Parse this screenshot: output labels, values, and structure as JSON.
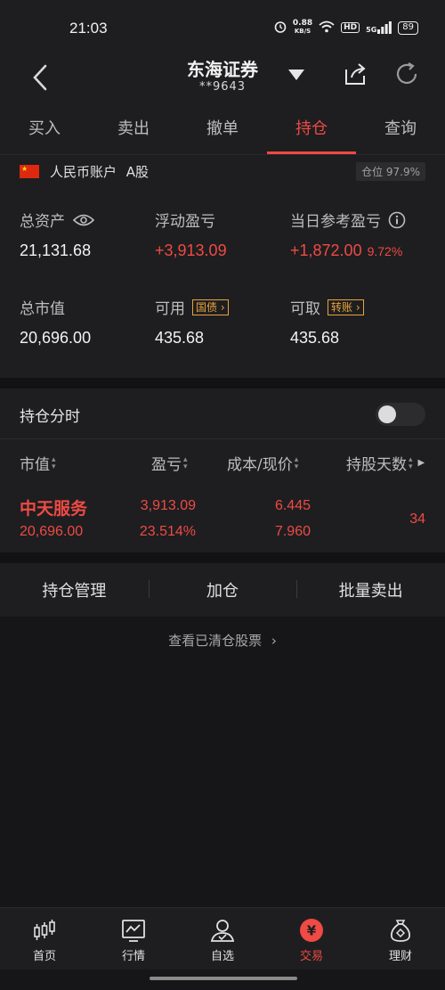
{
  "status": {
    "time": "21:03",
    "speed_value": "0.88",
    "speed_unit": "KB/S",
    "hd": "HD",
    "signal": "5G",
    "battery": "89"
  },
  "nav": {
    "title": "东海证券",
    "account_masked": "**9643"
  },
  "tabs": [
    {
      "label": "买入"
    },
    {
      "label": "卖出"
    },
    {
      "label": "撤单"
    },
    {
      "label": "持仓",
      "active": true
    },
    {
      "label": "查询"
    }
  ],
  "account": {
    "currency_label": "人民币账户",
    "market": "A股",
    "position_ratio": "仓位 97.9%",
    "total_assets_label": "总资产",
    "total_assets": "21,131.68",
    "floating_pl_label": "浮动盈亏",
    "floating_pl": "+3,913.09",
    "daily_pl_label": "当日参考盈亏",
    "daily_pl": "+1,872.00",
    "daily_pl_pct": "9.72%",
    "market_value_label": "总市值",
    "market_value": "20,696.00",
    "available_label": "可用",
    "available": "435.68",
    "bond_tag": "国债",
    "withdrawable_label": "可取",
    "withdrawable": "435.68",
    "transfer_tag": "转账"
  },
  "intraday_toggle": {
    "label": "持仓分时",
    "on": false
  },
  "table": {
    "headers": {
      "market_value": "市值",
      "pl": "盈亏",
      "cost_price": "成本/现价",
      "days": "持股天数"
    },
    "rows": [
      {
        "name": "中天服务",
        "market_value": "20,696.00",
        "pl": "3,913.09",
        "pl_pct": "23.514%",
        "cost": "6.445",
        "price": "7.960",
        "days": "34"
      }
    ]
  },
  "actions": {
    "manage": "持仓管理",
    "add": "加仓",
    "batch_sell": "批量卖出"
  },
  "cleared_link": "查看已清仓股票",
  "bottom_nav": [
    {
      "label": "首页",
      "icon": "candlestick-icon"
    },
    {
      "label": "行情",
      "icon": "chart-icon"
    },
    {
      "label": "自选",
      "icon": "user-icon"
    },
    {
      "label": "交易",
      "icon": "yuan-icon",
      "active": true
    },
    {
      "label": "理财",
      "icon": "money-bag-icon"
    }
  ],
  "colors": {
    "accent": "#ef4a44",
    "background": "#161618",
    "panel": "#1e1e20",
    "tag": "#e8a23c"
  }
}
